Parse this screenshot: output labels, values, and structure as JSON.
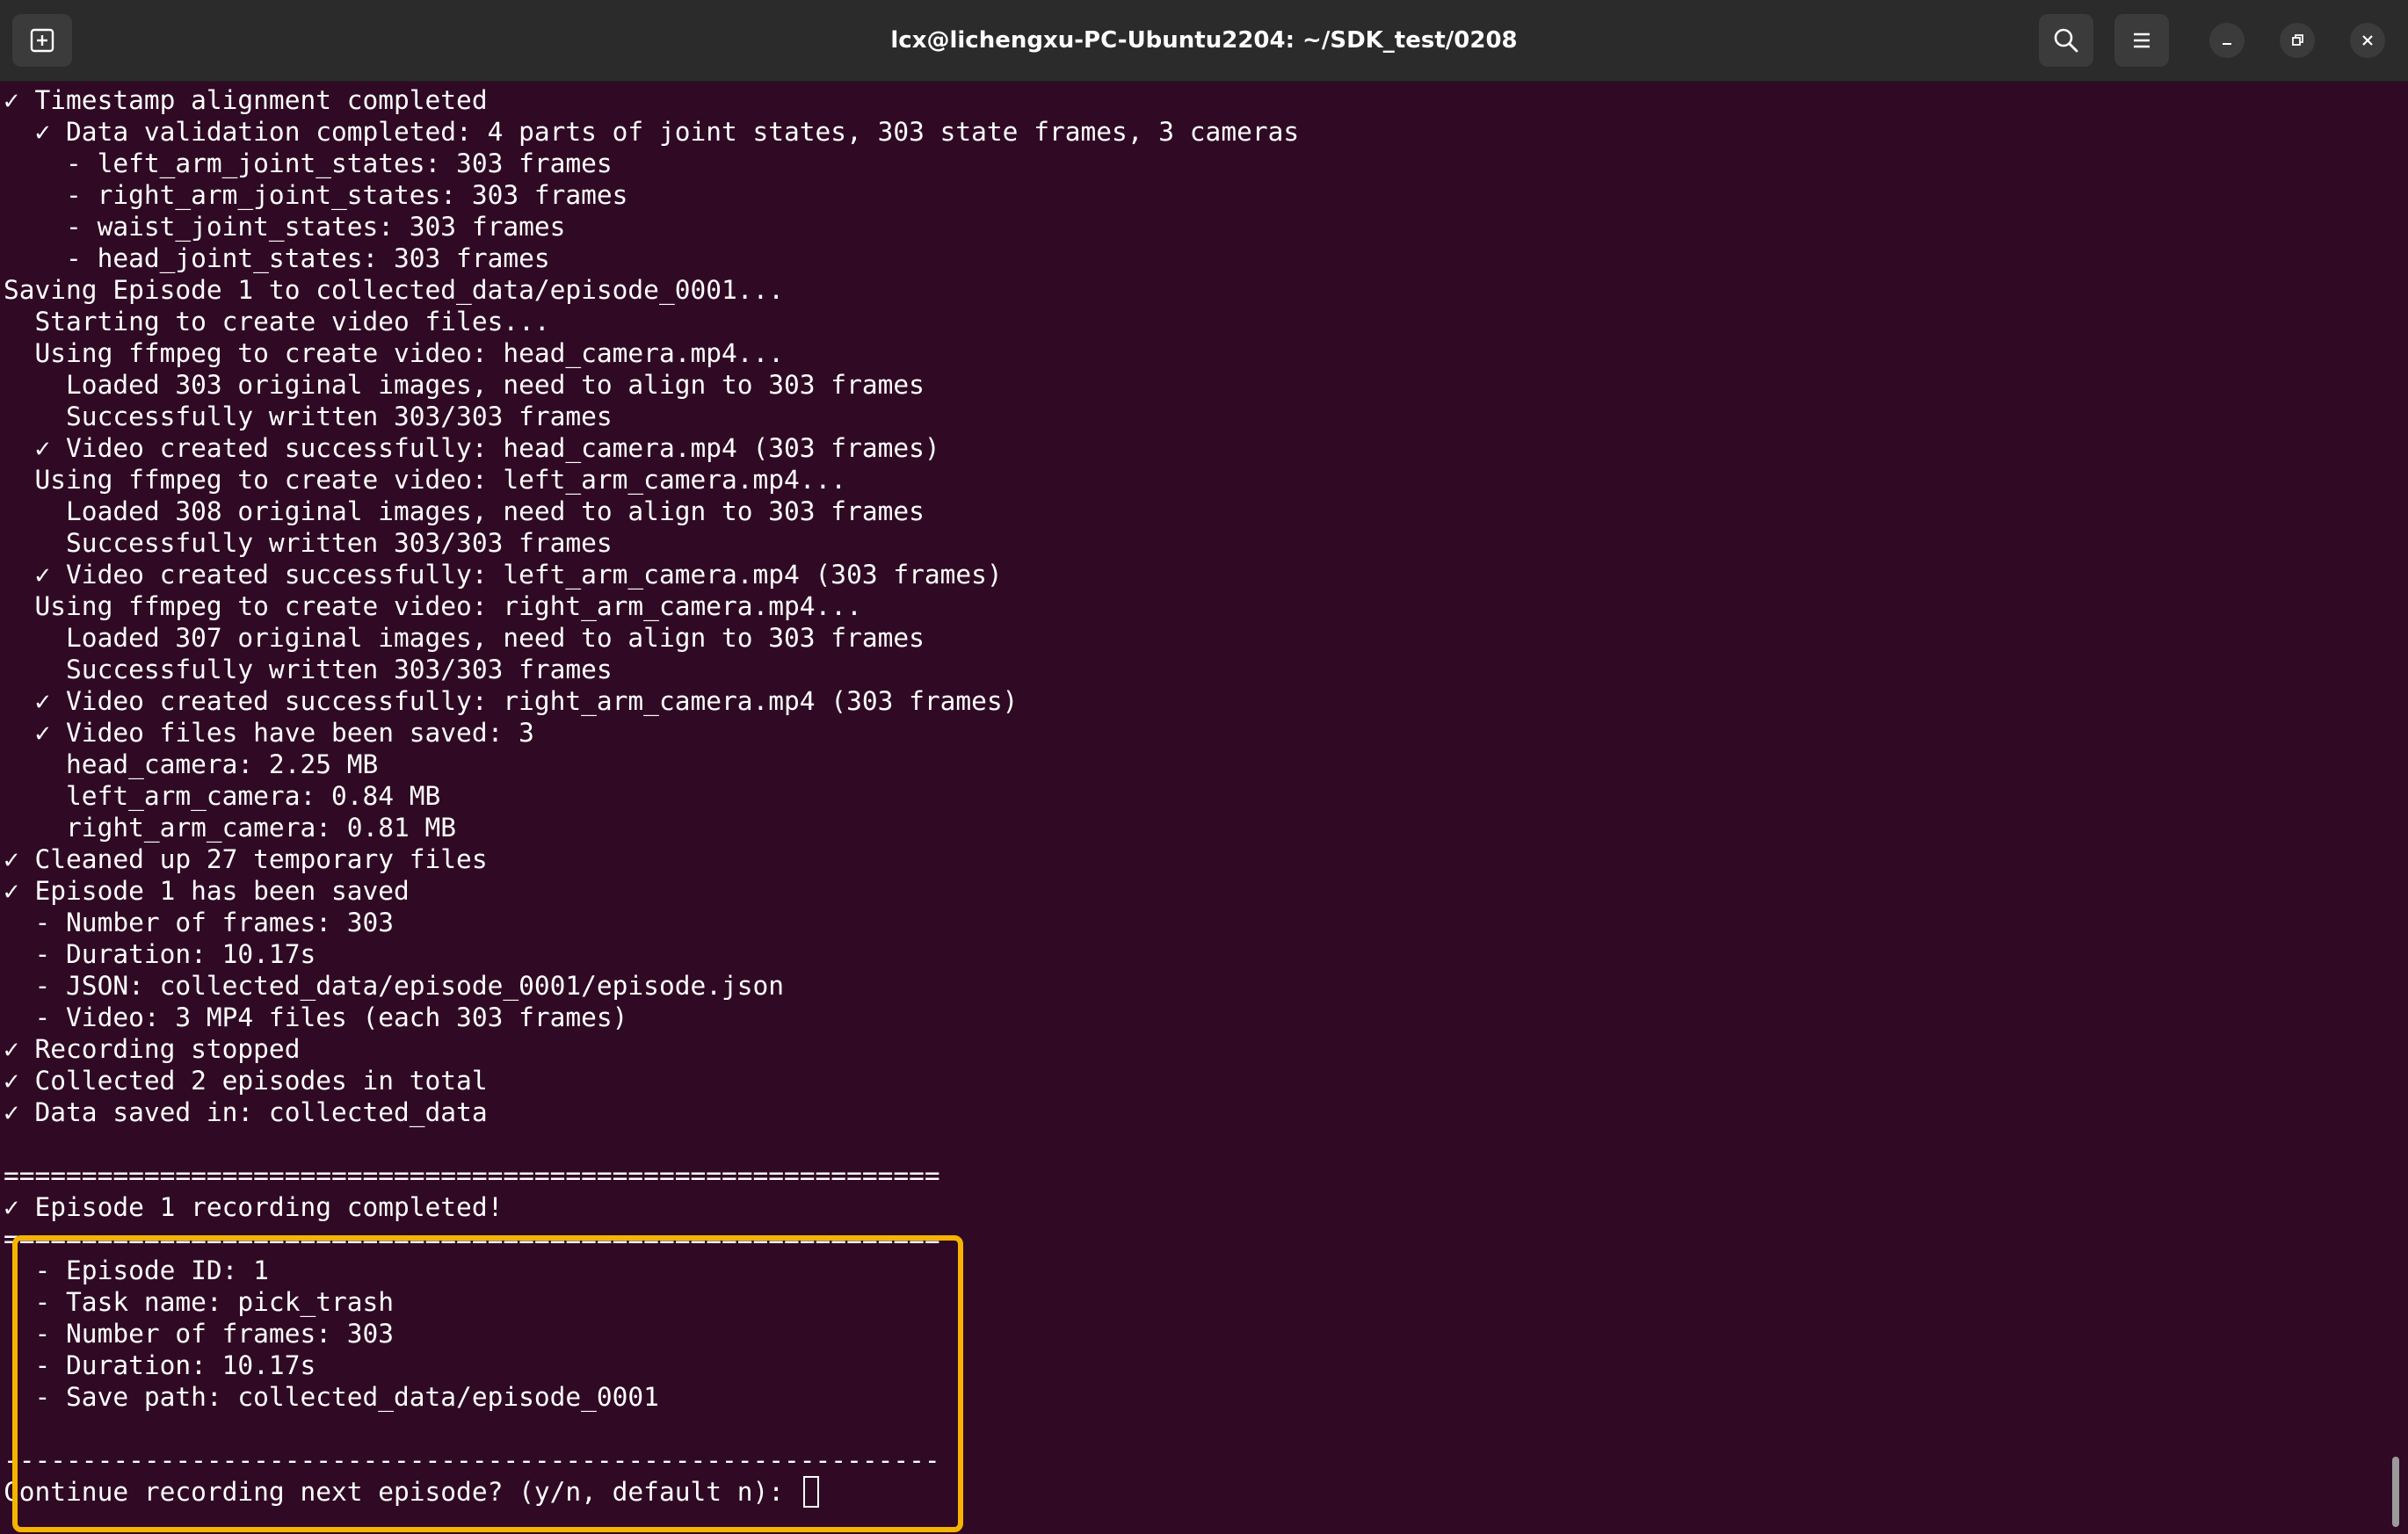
{
  "window": {
    "title": "lcx@lichengxu-PC-Ubuntu2204: ~/SDK_test/0208"
  },
  "icons": {
    "new_tab": "new-tab-icon",
    "search": "search-icon",
    "menu": "hamburger-menu-icon",
    "minimize": "minimize-icon",
    "maximize": "restore-icon",
    "close": "close-icon"
  },
  "colors": {
    "terminal_bg": "#300a24",
    "titlebar_bg": "#2b2b2b",
    "text": "#ffffff",
    "highlight": "#f5b400"
  },
  "terminal": {
    "lines": [
      "✓ Timestamp alignment completed",
      "  ✓ Data validation completed: 4 parts of joint states, 303 state frames, 3 cameras",
      "    - left_arm_joint_states: 303 frames",
      "    - right_arm_joint_states: 303 frames",
      "    - waist_joint_states: 303 frames",
      "    - head_joint_states: 303 frames",
      "Saving Episode 1 to collected_data/episode_0001...",
      "  Starting to create video files...",
      "  Using ffmpeg to create video: head_camera.mp4...",
      "    Loaded 303 original images, need to align to 303 frames",
      "    Successfully written 303/303 frames",
      "  ✓ Video created successfully: head_camera.mp4 (303 frames)",
      "  Using ffmpeg to create video: left_arm_camera.mp4...",
      "    Loaded 308 original images, need to align to 303 frames",
      "    Successfully written 303/303 frames",
      "  ✓ Video created successfully: left_arm_camera.mp4 (303 frames)",
      "  Using ffmpeg to create video: right_arm_camera.mp4...",
      "    Loaded 307 original images, need to align to 303 frames",
      "    Successfully written 303/303 frames",
      "  ✓ Video created successfully: right_arm_camera.mp4 (303 frames)",
      "  ✓ Video files have been saved: 3",
      "    head_camera: 2.25 MB",
      "    left_arm_camera: 0.84 MB",
      "    right_arm_camera: 0.81 MB",
      "✓ Cleaned up 27 temporary files",
      "✓ Episode 1 has been saved",
      "  - Number of frames: 303",
      "  - Duration: 10.17s",
      "  - JSON: collected_data/episode_0001/episode.json",
      "  - Video: 3 MP4 files (each 303 frames)",
      "✓ Recording stopped",
      "✓ Collected 2 episodes in total",
      "✓ Data saved in: collected_data",
      "",
      "============================================================",
      "✓ Episode 1 recording completed!",
      "============================================================",
      "  - Episode ID: 1",
      "  - Task name: pick_trash",
      "  - Number of frames: 303",
      "  - Duration: 10.17s",
      "  - Save path: collected_data/episode_0001",
      "",
      "------------------------------------------------------------"
    ],
    "prompt": "Continue recording next episode? (y/n, default n): "
  }
}
